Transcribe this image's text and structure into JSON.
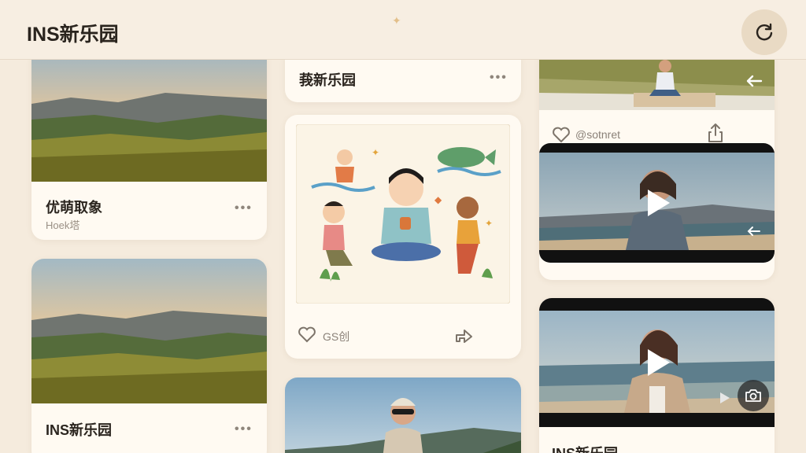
{
  "app": {
    "title": "INS新乐园"
  },
  "cards": {
    "c1": {
      "title": "优萌取象",
      "subtitle": "Hoek塔",
      "more": "•••"
    },
    "c2": {
      "title": "INS新乐园",
      "more": "•••"
    },
    "c3": {
      "title": "莪新乐园",
      "more": "•••"
    },
    "c4": {
      "likes": "GS创",
      "like_icon": "heart-outline",
      "share_icon": "share-arrow"
    },
    "c6": {
      "username": "@sotnret",
      "like_icon": "heart-outline",
      "share_icon": "share-up"
    },
    "c8": {
      "title": "INS新乐园"
    }
  },
  "colors": {
    "background": "#f5ebdd",
    "card": "#fffaf2",
    "accent": "#e9dac4"
  }
}
